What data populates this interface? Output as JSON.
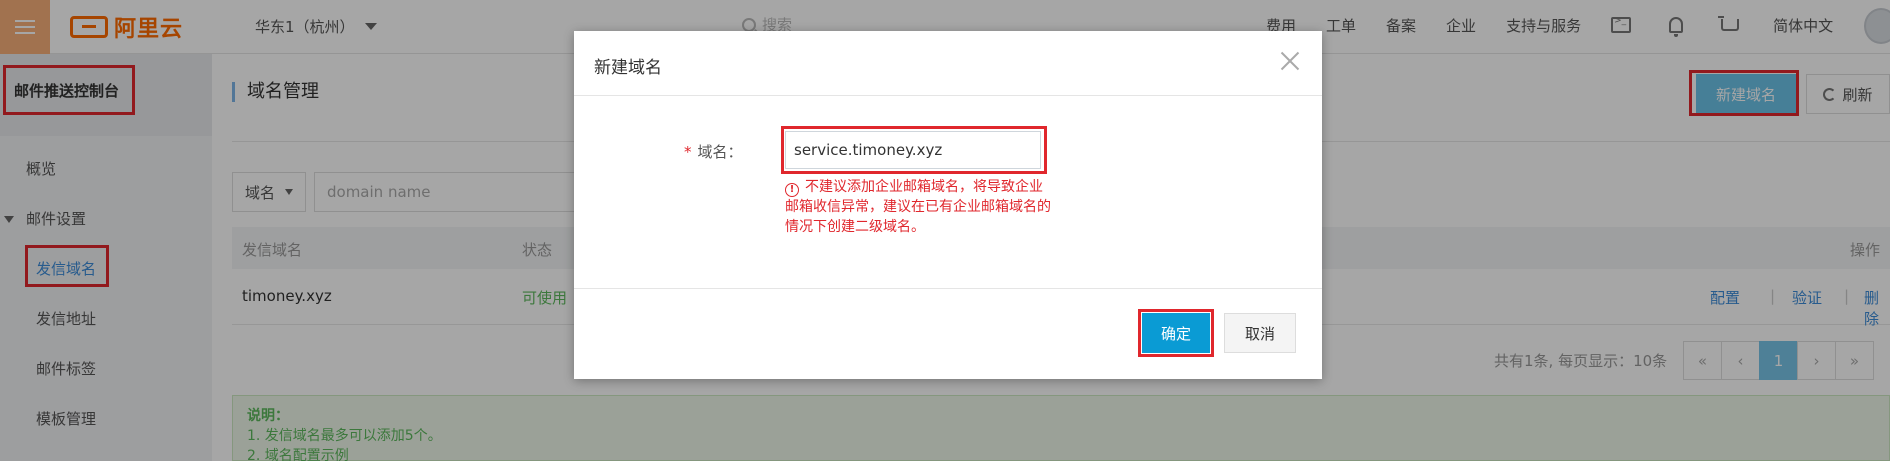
{
  "topbar": {
    "logo_text": "阿里云",
    "region": "华东1（杭州）",
    "search_placeholder": "搜索",
    "nav": [
      "费用",
      "工单",
      "备案",
      "企业",
      "支持与服务"
    ],
    "language": "简体中文",
    "icons": [
      "menu-icon",
      "terminal-icon",
      "bell-icon",
      "cart-icon"
    ]
  },
  "sidebar": {
    "title": "邮件推送控制台",
    "overview": "概览",
    "group_mail_settings": "邮件设置",
    "items": [
      "发信域名",
      "发信地址",
      "邮件标签",
      "模板管理"
    ]
  },
  "main": {
    "page_title": "域名管理",
    "new_domain_button": "新建域名",
    "refresh_button": "刷新",
    "filter": {
      "select_value": "域名",
      "placeholder": "domain name"
    },
    "table": {
      "headers": {
        "domain": "发信域名",
        "status": "状态",
        "actions": "操作"
      },
      "rows": [
        {
          "domain": "timoney.xyz",
          "status": "可使用",
          "actions": [
            "配置",
            "验证",
            "删除"
          ]
        }
      ]
    },
    "pagination": {
      "summary": "共有1条, 每页显示：10条",
      "buttons": [
        "«",
        "‹",
        "1",
        "›",
        "»"
      ],
      "current": "1"
    },
    "notice": {
      "title": "说明：",
      "lines": [
        "1. 发信域名最多可以添加5个。",
        "2. 域名配置示例"
      ]
    }
  },
  "modal": {
    "title": "新建域名",
    "field_label": "域名：",
    "required_mark": "*",
    "input_value": "service.timoney.xyz",
    "warning_icon": "!",
    "warning": "不建议添加企业邮箱域名，将导致企业邮箱收信异常，建议在已有企业邮箱域名的情况下创建二级域名。",
    "ok_button": "确定",
    "cancel_button": "取消"
  },
  "colors": {
    "brand": "#ff6a00",
    "primary": "#0a9bd4",
    "highlight_box": "#e0272d",
    "success": "#5cb85c",
    "link": "#3c8cd9"
  }
}
